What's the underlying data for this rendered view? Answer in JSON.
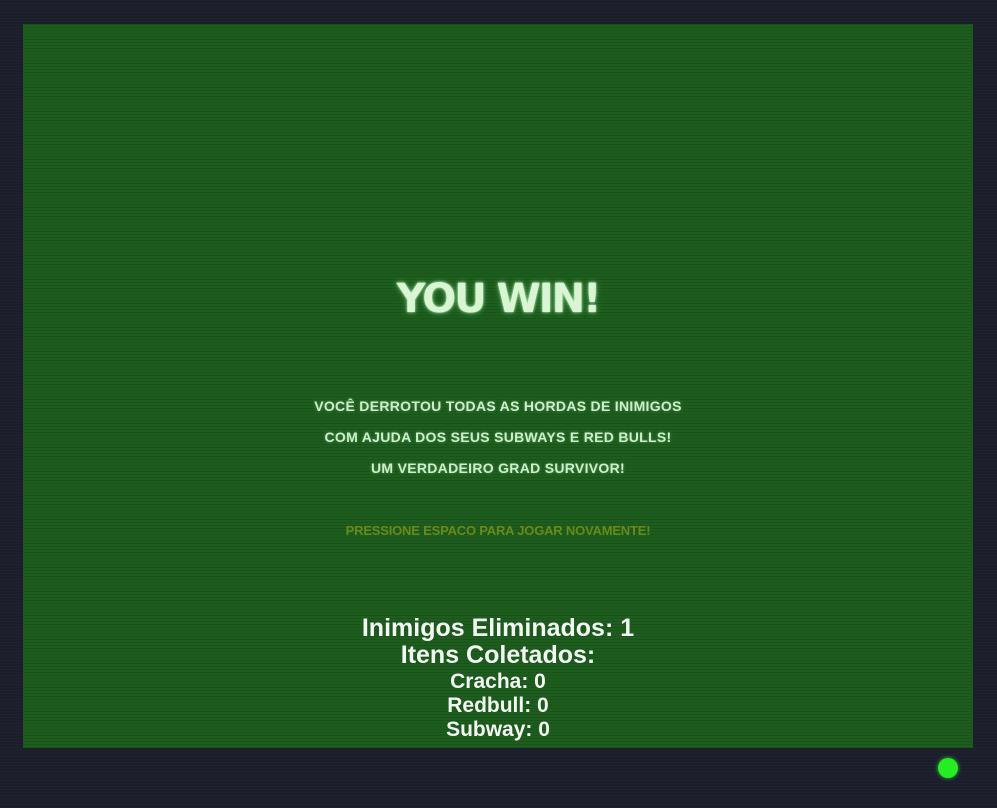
{
  "game_over": {
    "title": "YOU WIN!",
    "message_lines": [
      "VOCÊ DERROTOU TODAS AS HORDAS DE INIMIGOS",
      "COM AJUDA DOS SEUS SUBWAYS E RED BULLS!",
      "UM VERDADEIRO GRAD SURVIVOR!"
    ],
    "restart_prompt": "PRESSIONE ESPACO PARA JOGAR NOVAMENTE!"
  },
  "stats": {
    "enemies_killed": "Inimigos Eliminados: 1",
    "items_header": "Itens Coletados:",
    "cracha": "Cracha: 0",
    "redbull": "Redbull: 0",
    "subway": "Subway: 0"
  },
  "colors": {
    "background": "#1b1d2a",
    "screen": "#1d5e1e",
    "title": "#d9f5d3",
    "prompt": "#6a8a18",
    "status_dot": "#22ee22"
  },
  "icons": {
    "status": "status-dot-icon"
  }
}
